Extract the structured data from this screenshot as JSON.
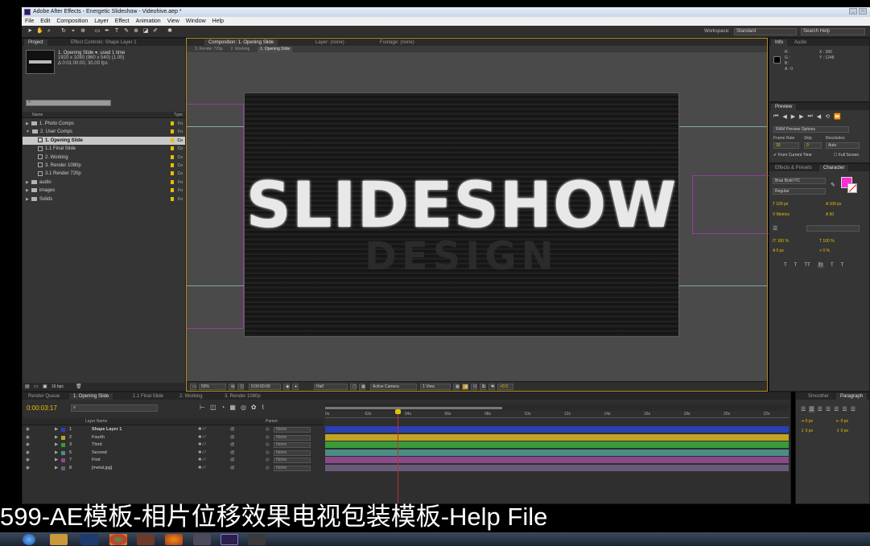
{
  "window": {
    "title": "Adobe After Effects - Energetic Slideshow - Videohive.aep *"
  },
  "menu": [
    "File",
    "Edit",
    "Composition",
    "Layer",
    "Effect",
    "Animation",
    "View",
    "Window",
    "Help"
  ],
  "toolbar": {
    "workspace_label": "Workspace:",
    "workspace_value": "Standard",
    "search_placeholder": "Search Help"
  },
  "project": {
    "tabs": [
      "Project",
      "Effect Controls: Shape Layer 1"
    ],
    "comp_name": "1. Opening Slide ▾, used 1 time",
    "comp_size": "1920 x 1080 (960 x 540) (1.00)",
    "comp_duration": "Δ 0:01:00:00, 30.00 fps",
    "col_name": "Name",
    "col_type": "Type",
    "items": [
      {
        "name": "1. Photo Comps",
        "type": "Fo",
        "kind": "folder",
        "indent": 0,
        "open": false
      },
      {
        "name": "2. User Comps",
        "type": "Fo",
        "kind": "folder",
        "indent": 0,
        "open": true
      },
      {
        "name": "1. Opening Slide",
        "type": "Co",
        "kind": "comp",
        "indent": 1,
        "selected": true
      },
      {
        "name": "1.1 Final Slide",
        "type": "Co",
        "kind": "comp",
        "indent": 1
      },
      {
        "name": "2. Working",
        "type": "Co",
        "kind": "comp",
        "indent": 1
      },
      {
        "name": "3. Render 1080p",
        "type": "Co",
        "kind": "comp",
        "indent": 1
      },
      {
        "name": "3.1 Render 720p",
        "type": "Co",
        "kind": "comp",
        "indent": 1
      },
      {
        "name": "audio",
        "type": "Fo",
        "kind": "folder",
        "indent": 0
      },
      {
        "name": "images",
        "type": "Fo",
        "kind": "folder",
        "indent": 0
      },
      {
        "name": "Solids",
        "type": "Fo",
        "kind": "folder",
        "indent": 0
      }
    ],
    "bpc": "16 bpc"
  },
  "viewer": {
    "tabs": [
      "Composition: 1. Opening Slide",
      "Layer: (none)",
      "Footage: (none)"
    ],
    "breadcrumbs": [
      "3. Render 720p",
      "2. Working",
      "1. Opening Slide"
    ],
    "frame_text": "SLIDESHOW",
    "ghost_text": "DESIGN",
    "zoom": "50%",
    "timecode": "0:00:00:00",
    "resolution": "Half",
    "camera": "Active Camera",
    "views": "1 View",
    "exposure": "+0.0"
  },
  "info": {
    "tabs": [
      "Info",
      "Audio"
    ],
    "rgb_labels": [
      "R :",
      "G :",
      "B :",
      "A : 0"
    ],
    "x": "X : 396",
    "y": "Y : 1248"
  },
  "preview": {
    "title": "Preview",
    "ram_options": "RAM Preview Options",
    "frame_rate_label": "Frame Rate",
    "skip_label": "Skip",
    "resolution_label": "Resolution",
    "frame_rate": "30",
    "skip": "0",
    "resolution": "Auto",
    "from_current": "From Current Time",
    "full_screen": "Full Screen"
  },
  "character": {
    "tabs": [
      "Effects & Presets",
      "Character"
    ],
    "font": "Bras Bold ITC",
    "style": "Regular",
    "size": "100 px",
    "leading": "100 px",
    "tracking": "50",
    "kerning": "Metrics",
    "vert_scale": "100 %",
    "horiz_scale": "100 %",
    "baseline": "0 px",
    "tsume": "0 %",
    "fill_color": "#ff2bd6"
  },
  "paragraph": {
    "tabs": [
      "Smoother",
      "Paragraph"
    ],
    "indent": "0 px"
  },
  "timeline": {
    "tabs": [
      "Render Queue",
      "1. Opening Slide",
      "1.1 Final Slide",
      "2. Working",
      "3. Render 1080p"
    ],
    "timecode": "0:00:03:17",
    "col_layer": "Layer Name",
    "col_parent": "Parent",
    "ruler": [
      "0s",
      "02s",
      "04s",
      "06s",
      "08s",
      "10s",
      "12s",
      "14s",
      "16s",
      "18s",
      "20s",
      "22s"
    ],
    "layers": [
      {
        "num": "1",
        "name": "Shape Layer 1",
        "parent": "None",
        "color": "#2c3fb3"
      },
      {
        "num": "2",
        "name": "Fourth",
        "parent": "None",
        "color": "#c2a323"
      },
      {
        "num": "3",
        "name": "Third",
        "parent": "None",
        "color": "#3a9b3a"
      },
      {
        "num": "5",
        "name": "Second",
        "parent": "None",
        "color": "#4a8e86"
      },
      {
        "num": "7",
        "name": "First",
        "parent": "None",
        "color": "#8a4a8a"
      },
      {
        "num": "8",
        "name": "[metal.jpg]",
        "parent": "None",
        "color": "#6a5a7a"
      }
    ]
  },
  "caption": "599-AE模板-相片位移效果电视包装模板-Help File"
}
